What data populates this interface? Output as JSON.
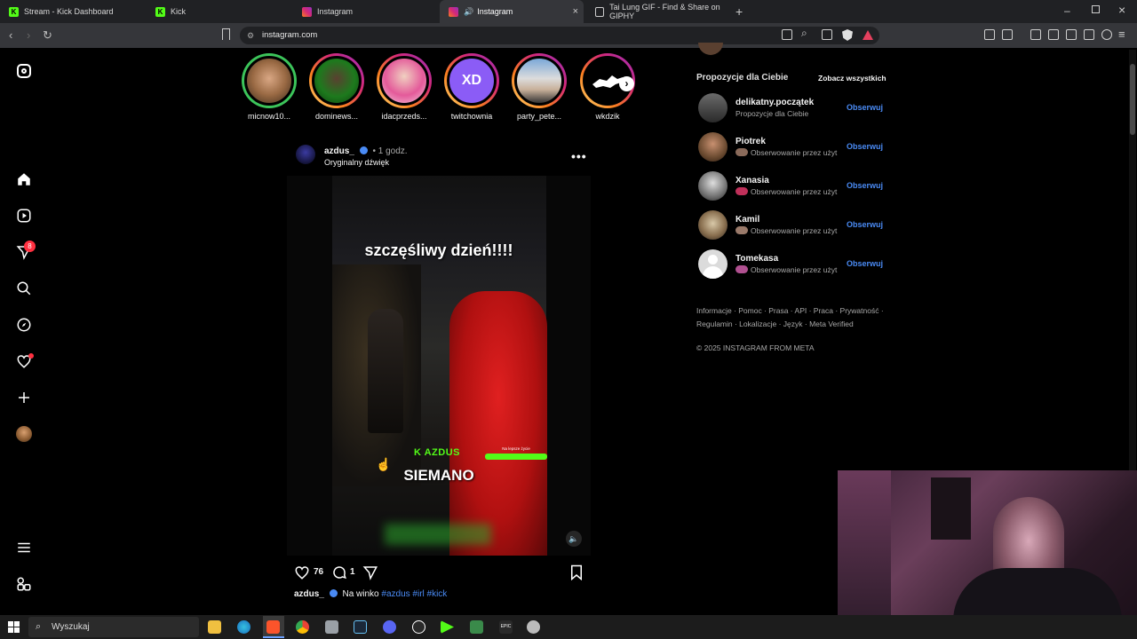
{
  "browser": {
    "tabs": [
      {
        "label": "Stream - Kick Dashboard",
        "favicon": "K",
        "color": "#53fc18"
      },
      {
        "label": "Kick",
        "favicon": "K",
        "color": "#53fc18"
      },
      {
        "label": "Instagram",
        "favicon": "ig",
        "color": "#d62976"
      },
      {
        "label": "Instagram",
        "favicon": "ig",
        "color": "#d62976",
        "active": true
      },
      {
        "label": "Tai Lung GIF - Find & Share on GIPHY",
        "favicon": "doc",
        "color": "#cccccc"
      }
    ],
    "url": "instagram.com",
    "new_tab": "+",
    "close": "×"
  },
  "sidebar": {
    "items": [
      "instagram-logo",
      "home",
      "reels",
      "messages",
      "search",
      "explore",
      "notifications",
      "create",
      "profile",
      "more",
      "also-from-meta"
    ],
    "messages_badge": "8"
  },
  "stories": [
    {
      "name": "micnow10...",
      "ring": "green"
    },
    {
      "name": "dominews...",
      "ring": "gradient"
    },
    {
      "name": "idacprzeds...",
      "ring": "gradient"
    },
    {
      "name": "twitchownia",
      "ring": "gradient"
    },
    {
      "name": "party_pete...",
      "ring": "gradient"
    },
    {
      "name": "wkdzik",
      "ring": "gradient"
    }
  ],
  "post": {
    "username": "azdus_",
    "time": "• 1 godz.",
    "audio": "Oryginalny dźwięk",
    "overlay_title": "szczęśliwy dzień!!!!",
    "overlay_brand": "K AZDUS",
    "overlay_caption": "SIEMANO",
    "overlay_tag": "Na lepsze życie",
    "likes": "76",
    "comments": "1",
    "caption_user": "azdus_",
    "caption_text": "Na winko",
    "caption_tags": "#azdus #irl #kick"
  },
  "suggestions": {
    "header": "Propozycje dla Ciebie",
    "see_all": "Zobacz wszystkich",
    "follow_label": "Obserwuj",
    "users": [
      {
        "name": "delikatny.początek",
        "sub": "Propozycje dla Ciebie"
      },
      {
        "name": "Piotrek",
        "sub": "Obserwowanie przez użyt"
      },
      {
        "name": "Xanasia",
        "sub": "Obserwowanie przez użyt"
      },
      {
        "name": "Kamil",
        "sub": "Obserwowanie przez użyt"
      },
      {
        "name": "Tomekasa",
        "sub": "Obserwowanie przez użyt"
      }
    ]
  },
  "footer": {
    "links_line1": "Informacje · Pomoc · Prasa · API · Praca · Prywatność ·",
    "links_line2": "Regulamin · Lokalizacje · Język · Meta Verified",
    "copyright": "© 2025 INSTAGRAM FROM META"
  },
  "taskbar": {
    "search_placeholder": "Wyszukaj"
  },
  "colors": {
    "accent_blue": "#4a8bf5",
    "kick_green": "#53fc18",
    "notification_red": "#ff3040"
  }
}
